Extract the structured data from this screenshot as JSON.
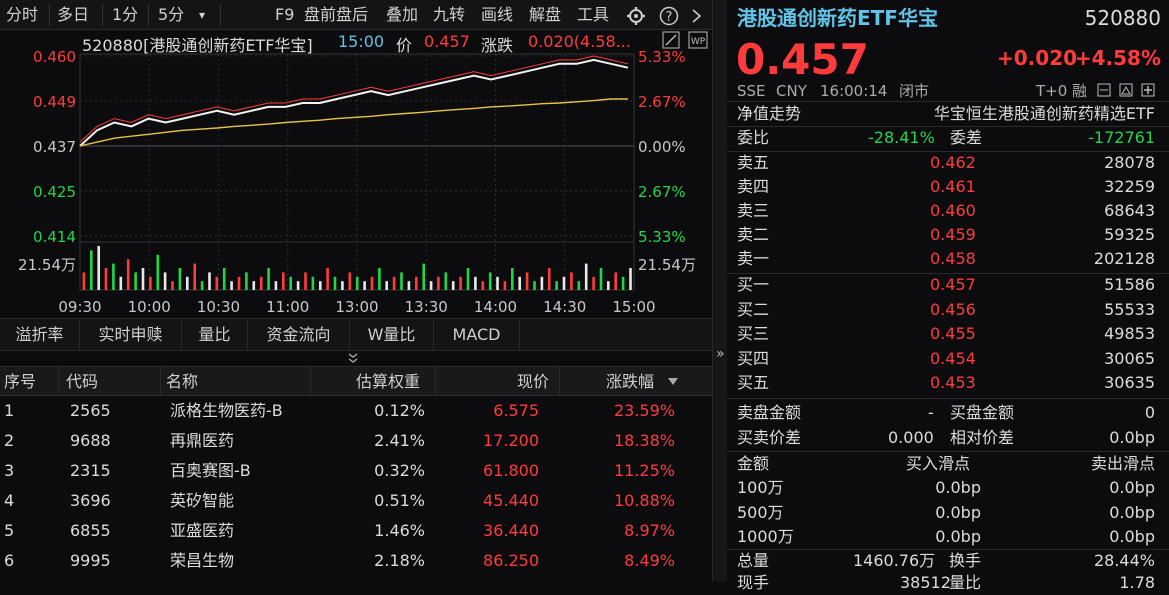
{
  "toolbar": {
    "items": [
      "分时",
      "多日",
      "1分",
      "5分",
      "▾",
      "F9",
      "盘前盘后",
      "叠加",
      "九转",
      "画线",
      "解盘",
      "工具"
    ],
    "settings_icon": "gear-icon",
    "help_icon": "help-icon",
    "next_icon": "chevron-right-icon"
  },
  "chart_info": {
    "name": "520880[港股通创新药ETF华宝]",
    "time": "15:00",
    "price_label": "价",
    "price": "0.457",
    "change_label": "涨跌",
    "change": "0.020(4.58..."
  },
  "chart_data": {
    "type": "line",
    "price_ticks": [
      "0.460",
      "0.449",
      "0.437",
      "0.425",
      "0.414"
    ],
    "pct_ticks": [
      "5.33%",
      "2.67%",
      "0.00%",
      "2.67%",
      "5.33%"
    ],
    "volume_label": "21.54万",
    "x_ticks": [
      "09:30",
      "10:00",
      "10:30",
      "11:00",
      "13:00",
      "13:30",
      "14:00",
      "14:30",
      "15:00"
    ],
    "ylim": [
      0.414,
      0.46
    ],
    "prev_close": 0.437,
    "series": [
      {
        "values": [
          0.437,
          0.441,
          0.443,
          0.442,
          0.444,
          0.443,
          0.444,
          0.445,
          0.446,
          0.445,
          0.446,
          0.447,
          0.447,
          0.448,
          0.448,
          0.449,
          0.45,
          0.451,
          0.45,
          0.451,
          0.452,
          0.453,
          0.454,
          0.455,
          0.454,
          0.455,
          0.456,
          0.457,
          0.458,
          0.458,
          0.459,
          0.458,
          0.457
        ]
      },
      {
        "values": [
          0.438,
          0.442,
          0.444,
          0.443,
          0.445,
          0.444,
          0.445,
          0.446,
          0.447,
          0.446,
          0.447,
          0.448,
          0.448,
          0.449,
          0.449,
          0.45,
          0.451,
          0.452,
          0.451,
          0.452,
          0.453,
          0.454,
          0.455,
          0.456,
          0.455,
          0.456,
          0.457,
          0.458,
          0.459,
          0.459,
          0.46,
          0.459,
          0.458
        ]
      },
      {
        "values": [
          0.437,
          0.438,
          0.439,
          0.4395,
          0.44,
          0.4405,
          0.441,
          0.4413,
          0.4416,
          0.442,
          0.4423,
          0.4426,
          0.443,
          0.4433,
          0.4436,
          0.444,
          0.4443,
          0.4446,
          0.445,
          0.4453,
          0.4456,
          0.446,
          0.4463,
          0.4466,
          0.447,
          0.4472,
          0.4475,
          0.4478,
          0.448,
          0.4483,
          0.4486,
          0.449,
          0.449
        ]
      }
    ],
    "volume": [
      0.4,
      0.9,
      1.0,
      0.5,
      0.6,
      0.3,
      0.7,
      0.4,
      0.5,
      0.3,
      0.8,
      0.4,
      0.2,
      0.5,
      0.3,
      0.6,
      0.2,
      0.4,
      0.3,
      0.5,
      0.2,
      0.3,
      0.4,
      0.2,
      0.3,
      0.5,
      0.2,
      0.4,
      0.3,
      0.2,
      0.4,
      0.3,
      0.2,
      0.5,
      0.3,
      0.2,
      0.4,
      0.3,
      0.2,
      0.3,
      0.5,
      0.2,
      0.3,
      0.4,
      0.2,
      0.3,
      0.6,
      0.2,
      0.3,
      0.4,
      0.2,
      0.3,
      0.5,
      0.3,
      0.2,
      0.4,
      0.3,
      0.2,
      0.5,
      0.3,
      0.4,
      0.2,
      0.3,
      0.5,
      0.2,
      0.3,
      0.4,
      0.2,
      0.6,
      0.3,
      0.5,
      0.2,
      0.4,
      0.3,
      0.5
    ],
    "volume_colors": [
      "#ff3b3b",
      "#1fd64b",
      "#e8e8e8"
    ]
  },
  "sub_tabs": [
    "溢折率",
    "实时申赎",
    "量比",
    "资金流向",
    "W量比",
    "MACD"
  ],
  "collapse_icon": "double-chevron-down-icon",
  "table": {
    "headers": [
      "序号",
      "代码",
      "名称",
      "估算权重",
      "现价",
      "涨跌幅"
    ],
    "sort_icon": "sort-down-icon",
    "rows": [
      {
        "idx": "1",
        "code": "2565",
        "name": "派格生物医药-B",
        "weight": "0.12%",
        "price": "6.575",
        "chg": "23.59%"
      },
      {
        "idx": "2",
        "code": "9688",
        "name": "再鼎医药",
        "weight": "2.41%",
        "price": "17.200",
        "chg": "18.38%"
      },
      {
        "idx": "3",
        "code": "2315",
        "name": "百奥赛图-B",
        "weight": "0.32%",
        "price": "61.800",
        "chg": "11.25%"
      },
      {
        "idx": "4",
        "code": "3696",
        "name": "英矽智能",
        "weight": "0.51%",
        "price": "45.440",
        "chg": "10.88%"
      },
      {
        "idx": "5",
        "code": "6855",
        "name": "亚盛医药",
        "weight": "1.46%",
        "price": "36.440",
        "chg": "8.97%"
      },
      {
        "idx": "6",
        "code": "9995",
        "name": "荣昌生物",
        "weight": "2.18%",
        "price": "86.250",
        "chg": "8.49%"
      }
    ]
  },
  "side_toggle": "»",
  "quote": {
    "title": "港股通创新药ETF华宝",
    "code": "520880",
    "price": "0.457",
    "change": "+0.020",
    "change_pct": "+4.58%",
    "exchange": "SSE",
    "currency": "CNY",
    "time": "16:00:14",
    "status": "闭市",
    "tags": "T+0 融",
    "nav_label": "净值走势",
    "full_name": "华宝恒生港股通创新药精选ETF",
    "weibi_label": "委比",
    "weibi": "-28.41%",
    "weicha_label": "委差",
    "weicha": "-172761",
    "asks": [
      {
        "label": "卖五",
        "price": "0.462",
        "vol": "28078"
      },
      {
        "label": "卖四",
        "price": "0.461",
        "vol": "32259"
      },
      {
        "label": "卖三",
        "price": "0.460",
        "vol": "68643"
      },
      {
        "label": "卖二",
        "price": "0.459",
        "vol": "59325"
      },
      {
        "label": "卖一",
        "price": "0.458",
        "vol": "202128"
      }
    ],
    "bids": [
      {
        "label": "买一",
        "price": "0.457",
        "vol": "51586"
      },
      {
        "label": "买二",
        "price": "0.456",
        "vol": "55533"
      },
      {
        "label": "买三",
        "price": "0.455",
        "vol": "49853"
      },
      {
        "label": "买四",
        "price": "0.454",
        "vol": "30065"
      },
      {
        "label": "买五",
        "price": "0.453",
        "vol": "30635"
      }
    ],
    "sell_amt_label": "卖盘金额",
    "sell_amt": "-",
    "buy_amt_label": "买盘金额",
    "buy_amt": "0",
    "spread_label": "买卖价差",
    "spread": "0.000",
    "rel_spread_label": "相对价差",
    "rel_spread": "0.0bp",
    "slip_headers": [
      "金额",
      "买入滑点",
      "卖出滑点"
    ],
    "slips": [
      {
        "amt": "100万",
        "buy": "0.0bp",
        "sell": "0.0bp"
      },
      {
        "amt": "500万",
        "buy": "0.0bp",
        "sell": "0.0bp"
      },
      {
        "amt": "1000万",
        "buy": "0.0bp",
        "sell": "0.0bp"
      }
    ],
    "total_vol_label": "总量",
    "total_vol": "1460.76万",
    "turnover_label": "换手",
    "turnover": "28.44%",
    "cur_vol_label": "现手",
    "cur_vol": "38512",
    "vol_ratio_label": "量比",
    "vol_ratio": "1.78"
  }
}
